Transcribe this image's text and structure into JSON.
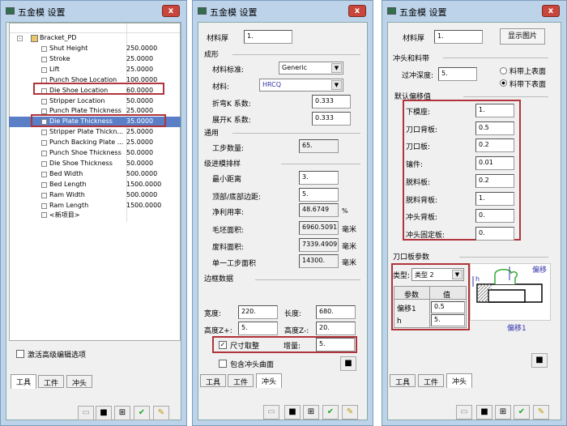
{
  "window_title": "五金模 设置",
  "close_label": "x",
  "left": {
    "tree_root": "Bracket_PD",
    "rows": [
      {
        "name": "Shut Height",
        "value": "250.0000"
      },
      {
        "name": "Stroke",
        "value": "25.0000"
      },
      {
        "name": "Lift",
        "value": "25.0000"
      },
      {
        "name": "Punch Shoe Location",
        "value": "100.0000"
      },
      {
        "name": "Die Shoe Location",
        "value": "60.0000"
      },
      {
        "name": "Stripper Location",
        "value": "50.0000"
      },
      {
        "name": "Punch Plate Thickness",
        "value": "25.0000"
      },
      {
        "name": "Die Plate Thickness",
        "value": "35.0000"
      },
      {
        "name": "Stripper Plate Thickn...",
        "value": "25.0000"
      },
      {
        "name": "Punch Backing Plate ...",
        "value": "25.0000"
      },
      {
        "name": "Punch Shoe Thickness",
        "value": "50.0000"
      },
      {
        "name": "Die Shoe Thickness",
        "value": "50.0000"
      },
      {
        "name": "Bed Width",
        "value": "500.0000"
      },
      {
        "name": "Bed Length",
        "value": "1500.0000"
      },
      {
        "name": "Ram Width",
        "value": "500.0000"
      },
      {
        "name": "Ram Length",
        "value": "1500.0000"
      }
    ],
    "new_item": "<新项目>",
    "advanced_checkbox": "激活高级编辑选项"
  },
  "tabs": [
    "工具",
    "工件",
    "冲头"
  ],
  "middle": {
    "thickness_label": "材料厚",
    "thickness": "1.",
    "forming": "成形",
    "material_std_label": "材料标准:",
    "material_std": "Generic",
    "material_label": "材料:",
    "material": "HRCQ",
    "bend_k_label": "折弯K 系数:",
    "bend_k": "0.333",
    "unfold_k_label": "展开K 系数:",
    "unfold_k": "0.333",
    "general": "通用",
    "steps_label": "工步数量:",
    "steps": "65.",
    "layout": "级进模排样",
    "min_dist_label": "最小距离",
    "min_dist": "3.",
    "margin_label": "顶部/底部边距:",
    "margin": "5.",
    "util_label": "净利用率:",
    "util": "48.6749",
    "util_unit": "%",
    "blank_label": "毛坯面积:",
    "blank": "6960.5091",
    "scrap_label": "废料面积:",
    "scrap": "7339.4909",
    "step_area_label": "单一工步面积",
    "step_area": "14300.",
    "unit_mm": "毫米",
    "frame": "边框数据",
    "width_label": "宽度:",
    "width": "220.",
    "length_label": "长度:",
    "length": "680.",
    "zplus_label": "高度Z+:",
    "zplus": "5.",
    "zminus_label": "高度Z-:",
    "zminus": "20.",
    "round_label": "尺寸取整",
    "increment_label": "增量:",
    "increment": "5.",
    "include_label": "包含冲头曲面"
  },
  "right": {
    "thickness_label": "材料厚",
    "thickness": "1.",
    "show_image": "显示图片",
    "punch_strip": "冲头和料带",
    "overpunch_label": "过冲深度:",
    "overpunch": "5.",
    "radio_top": "料带上表面",
    "radio_bottom": "料带下表面",
    "default_offsets": "默认偏移值",
    "offsets": [
      {
        "label": "下模座:",
        "value": "1."
      },
      {
        "label": "刀口背板:",
        "value": "0.5"
      },
      {
        "label": "刀口板:",
        "value": "0.2"
      },
      {
        "label": "镶件:",
        "value": "0.01"
      },
      {
        "label": "脱料板:",
        "value": "0.2"
      },
      {
        "label": "脱料背板:",
        "value": "1."
      },
      {
        "label": "冲头背板:",
        "value": "0."
      },
      {
        "label": "冲头固定板:",
        "value": "0."
      }
    ],
    "die_params": "刀口板参数",
    "type_label": "类型:",
    "type": "类型 2",
    "col_param": "参数",
    "col_value": "值",
    "params": [
      {
        "name": "偏移1",
        "value": "0.5"
      },
      {
        "name": "h",
        "value": "5."
      }
    ],
    "diagram_offset": "偏移",
    "diagram_offset1": "偏移1",
    "diagram_h": "h"
  },
  "colors": {
    "accent_red": "#b0343b",
    "selection": "#5b7fc7"
  }
}
